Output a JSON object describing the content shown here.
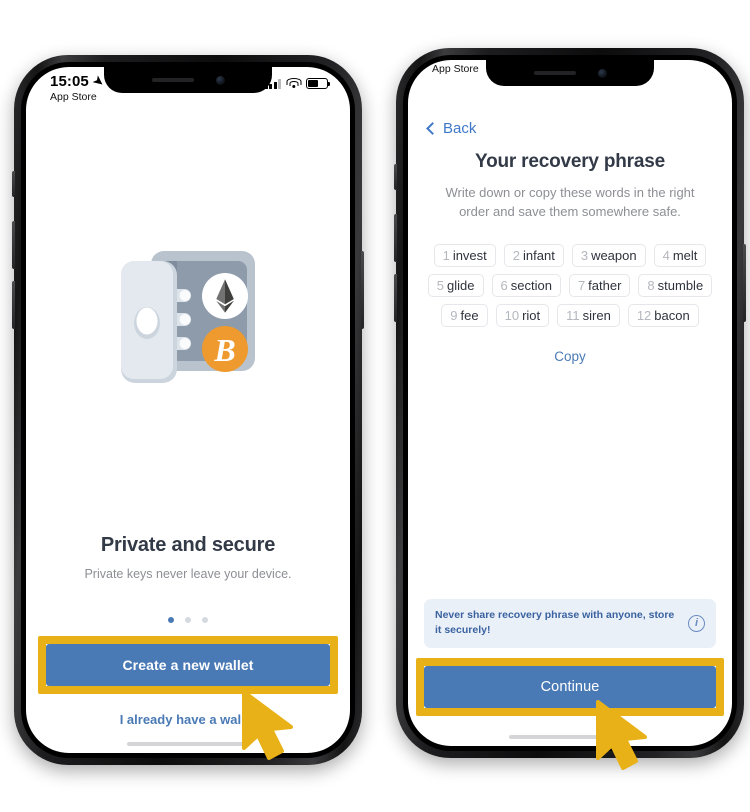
{
  "left_phone": {
    "status_bar": {
      "time": "15:05",
      "location_icon": "location-arrow-icon",
      "app_label": "App Store",
      "signal_icon": "cellular-signal-icon",
      "wifi_icon": "wifi-icon",
      "battery_icon": "battery-icon"
    },
    "illustration": "safe-vault-with-crypto-coins-illustration",
    "title": "Private and secure",
    "subtitle": "Private keys never leave your device.",
    "page_dots": {
      "total": 3,
      "active_index": 0
    },
    "primary_button": "Create a new wallet",
    "secondary_link": "I already have a wallet",
    "highlight_target": "primary_button"
  },
  "right_phone": {
    "status_bar": {
      "app_label": "App Store"
    },
    "back_label": "Back",
    "title": "Your recovery phrase",
    "subtitle": "Write down or copy these words in the right order and save them somewhere safe.",
    "words": [
      {
        "n": "1",
        "word": "invest"
      },
      {
        "n": "2",
        "word": "infant"
      },
      {
        "n": "3",
        "word": "weapon"
      },
      {
        "n": "4",
        "word": "melt"
      },
      {
        "n": "5",
        "word": "glide"
      },
      {
        "n": "6",
        "word": "section"
      },
      {
        "n": "7",
        "word": "father"
      },
      {
        "n": "8",
        "word": "stumble"
      },
      {
        "n": "9",
        "word": "fee"
      },
      {
        "n": "10",
        "word": "riot"
      },
      {
        "n": "11",
        "word": "siren"
      },
      {
        "n": "12",
        "word": "bacon"
      }
    ],
    "copy_link": "Copy",
    "warning": {
      "text": "Never share recovery phrase with anyone, store it securely!",
      "icon": "info-circle-icon"
    },
    "primary_button": "Continue",
    "highlight_target": "primary_button"
  },
  "colors": {
    "accent_blue": "#4a7ab5",
    "link_blue": "#3f78c8",
    "highlight_gold": "#e8b117",
    "title_dark": "#333a47",
    "muted_gray": "#8d8f95",
    "warning_bg": "#eaf0f7",
    "warning_text": "#3a62a0",
    "bitcoin_orange": "#ef9a2e",
    "safe_body": "#9aa6b4",
    "safe_door": "#dde3ea"
  }
}
